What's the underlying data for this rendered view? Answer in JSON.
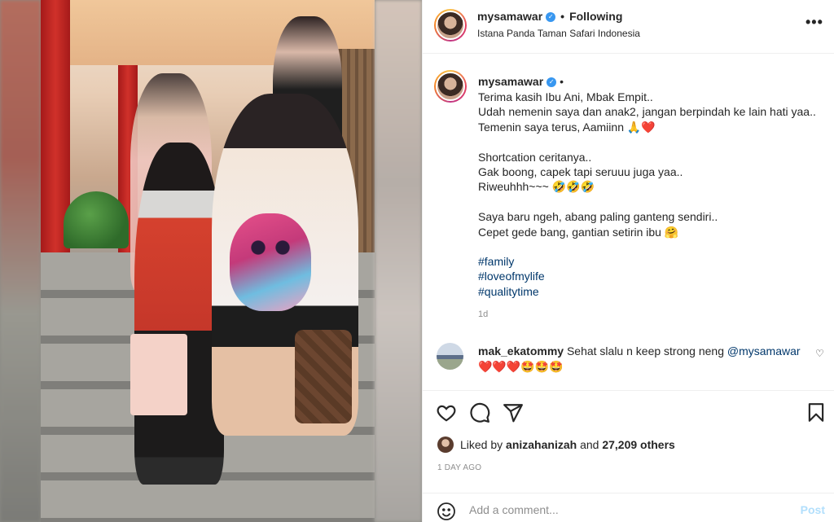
{
  "post": {
    "username": "mysamawar",
    "verified_symbol": "✓",
    "follow_separator": "•",
    "follow_status": "Following",
    "location": "Istana Panda Taman Safari Indonesia",
    "more_symbol": "•••"
  },
  "caption": {
    "username": "mysamawar",
    "dot": "•",
    "text": "Terima kasih Ibu Ani, Mbak Empit..\nUdah nemenin saya dan anak2, jangan berpindah ke lain hati yaa..\nTemenin saya terus, Aamiinn 🙏❤️\n\nShortcation ceritanya..\nGak boong, capek tapi seruuu juga yaa..\nRiweuhhh~~~ 🤣🤣🤣\n\nSaya baru ngeh, abang paling ganteng sendiri..\nCepet gede bang, gantian setirin ibu 🤗",
    "hashtags": [
      "#family",
      "#loveofmylife",
      "#qualitytime"
    ],
    "time_ago": "1d"
  },
  "comments": [
    {
      "username": "mak_ekatommy",
      "text": " Sehat slalu n keep strong neng ",
      "mention": "@mysamawar",
      "emoji_line": "❤️❤️❤️🤩🤩🤩",
      "like_symbol": "♡"
    }
  ],
  "actions": {
    "like_icon": "heart-icon",
    "comment_icon": "comment-icon",
    "share_icon": "share-icon",
    "save_icon": "bookmark-icon"
  },
  "likes": {
    "prefix": "Liked by ",
    "user": "anizahanizah",
    "middle": " and ",
    "count": "27,209 others"
  },
  "date": "1 DAY AGO",
  "comment_box": {
    "placeholder": "Add a comment...",
    "post_label": "Post"
  },
  "colors": {
    "link": "#00376b",
    "verified": "#3897f0",
    "muted": "#8e8e8e",
    "post_disabled": "#b2dffc"
  }
}
